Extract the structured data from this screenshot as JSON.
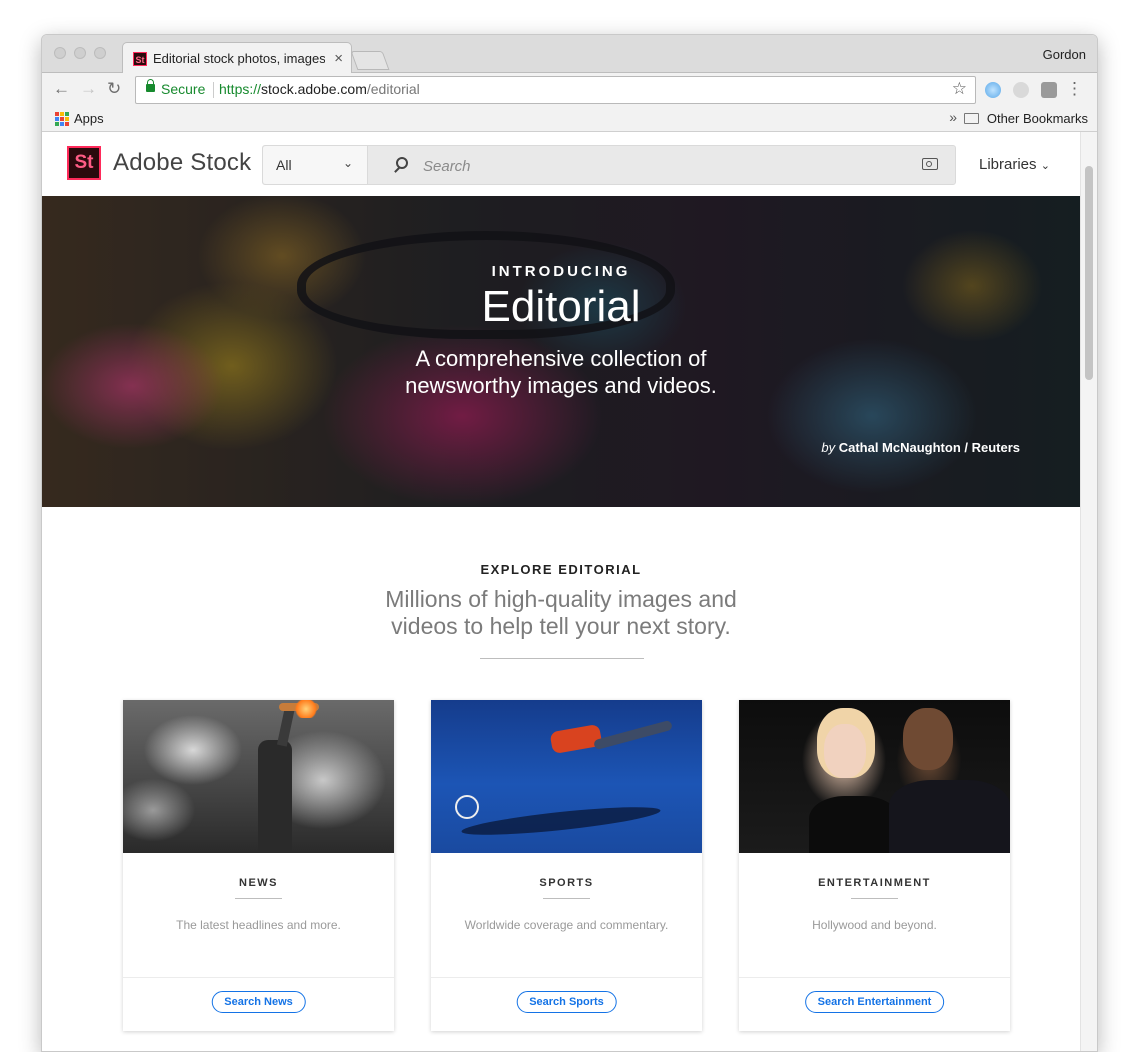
{
  "browser": {
    "tab_title": "Editorial stock photos, images",
    "tab_favicon_text": "St",
    "tab_close": "×",
    "profile_name": "Gordon",
    "security_label": "Secure",
    "url": {
      "scheme": "https://",
      "host": "stock.adobe.com",
      "path": "/editorial"
    },
    "bookmarks": {
      "apps_label": "Apps",
      "overflow": "»",
      "other_label": "Other Bookmarks"
    }
  },
  "site": {
    "logo_text": "St",
    "brand": "Adobe Stock",
    "search": {
      "category": "All",
      "placeholder": "Search"
    },
    "libraries_label": "Libraries",
    "accent_color": "#ff2a5a",
    "link_color": "#1473e6"
  },
  "hero": {
    "kicker": "INTRODUCING",
    "title": "Editorial",
    "subtitle_line1": "A comprehensive collection of",
    "subtitle_line2": "newsworthy images and videos.",
    "credit_prefix": "by",
    "credit": "Cathal McNaughton / Reuters"
  },
  "explore": {
    "kicker": "EXPLORE EDITORIAL",
    "headline_line1": "Millions of high-quality images and",
    "headline_line2": "videos to help tell your next story."
  },
  "cards": [
    {
      "label": "NEWS",
      "description": "The latest headlines and more.",
      "button": "Search News"
    },
    {
      "label": "SPORTS",
      "description": "Worldwide coverage and commentary.",
      "button": "Search Sports"
    },
    {
      "label": "ENTERTAINMENT",
      "description": "Hollywood and beyond.",
      "button": "Search Entertainment"
    }
  ]
}
